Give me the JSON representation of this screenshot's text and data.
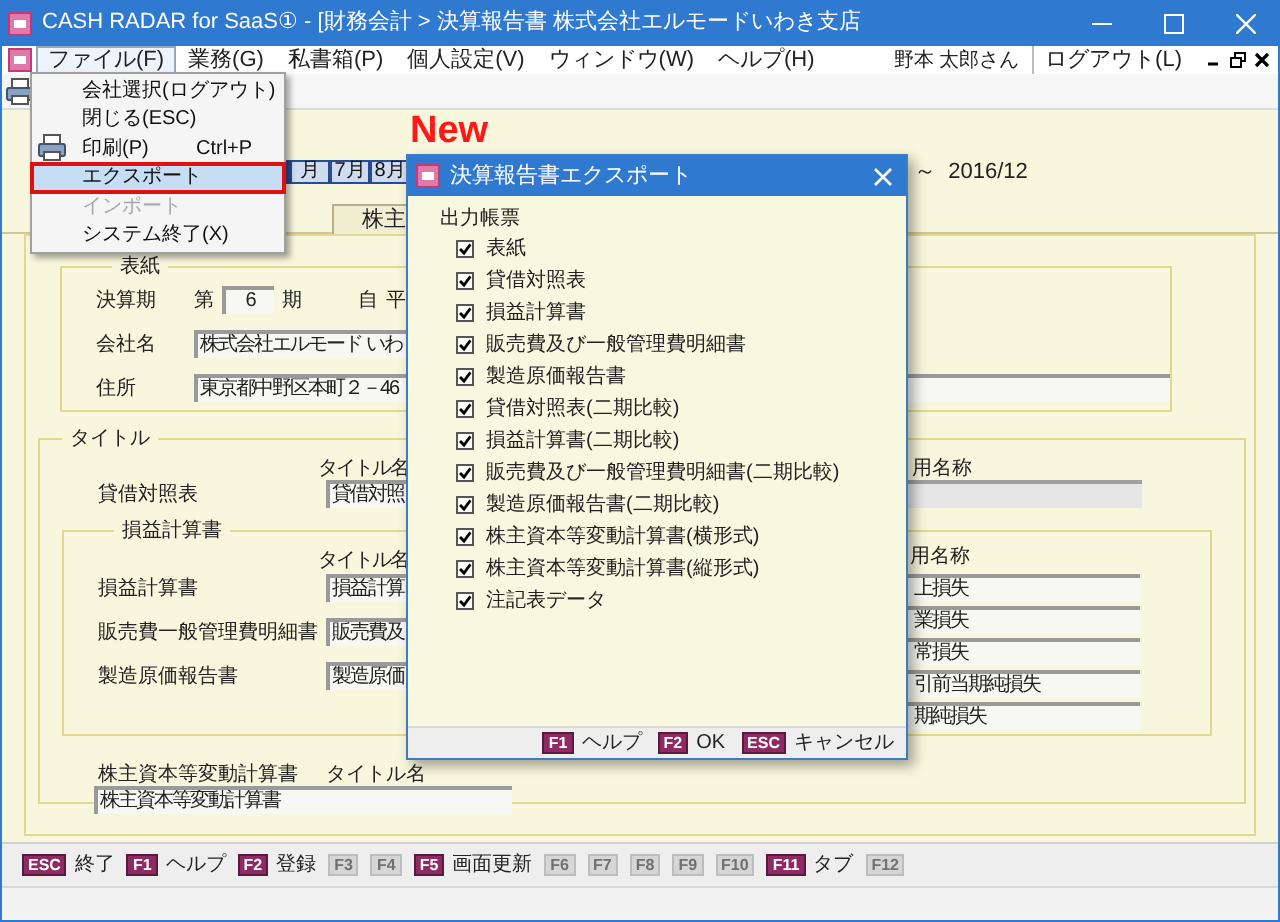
{
  "window": {
    "title": "CASH RADAR for SaaS① - [財務会計 > 決算報告書 株式会社エルモードいわき支店"
  },
  "menu_bar": {
    "items": [
      {
        "label": "ファイル(F)",
        "selected": true
      },
      {
        "label": "業務(G)",
        "selected": false
      },
      {
        "label": "私書箱(P)",
        "selected": false
      },
      {
        "label": "個人設定(V)",
        "selected": false
      },
      {
        "label": "ウィンドウ(W)",
        "selected": false
      },
      {
        "label": "ヘルプ(H)",
        "selected": false
      }
    ],
    "user": "野本 太郎さん",
    "logout": "ログアウト(L)"
  },
  "file_menu": {
    "items": [
      {
        "label": "会社選択(ログアウト)",
        "selected": false,
        "disabled": false
      },
      {
        "label": "閉じる(ESC)",
        "selected": false,
        "disabled": false
      },
      {
        "label": "印刷(P)",
        "shortcut": "Ctrl+P",
        "kind": "print",
        "selected": false,
        "disabled": false
      },
      {
        "label": "エクスポート",
        "selected": true,
        "disabled": false
      },
      {
        "label": "インポート",
        "selected": false,
        "disabled": true
      },
      {
        "label": "システム終了(X)",
        "selected": false,
        "disabled": false
      }
    ]
  },
  "annotation": "New",
  "period_bar": {
    "months": [
      "月",
      "7月",
      "8月"
    ],
    "range": "～  2016/12"
  },
  "tabs": [
    {
      "label": "株主",
      "selected": false
    }
  ],
  "cover": {
    "legend": "表紙",
    "period_label": "決算期",
    "period_prefix": "第",
    "period_value": "6",
    "period_suffix": "期",
    "from_label": "自",
    "from_value": "平",
    "company_label": "会社名",
    "company_value": "株式会社エルモード いわ",
    "address_label": "住所",
    "address_value": "東京都中野区本町２－46"
  },
  "titles": {
    "legend": "タイトル",
    "header_title": "タイトル名",
    "header_alt": "用名称",
    "rows": [
      {
        "label": "貸借対照表",
        "value": "貸借対照"
      }
    ]
  },
  "income": {
    "legend": "損益計算書",
    "header_title": "タイトル名",
    "header_alt": "用名称",
    "rows": [
      {
        "label": "損益計算書",
        "value": "損益計算"
      },
      {
        "label": "販売費一般管理費明細書",
        "value": "販売費及"
      },
      {
        "label": "製造原価報告書",
        "value": "製造原価"
      }
    ],
    "alt_values": [
      "上損失",
      "業損失",
      "常損失",
      "引前当期純損失",
      "期純損失"
    ]
  },
  "equity": {
    "label": "株主資本等変動計算書",
    "header_title": "タイトル名",
    "value": "株主資本等変動計算書"
  },
  "function_keys": [
    {
      "key": "ESC",
      "label": "終了",
      "disabled": false
    },
    {
      "key": "F1",
      "label": "ヘルプ",
      "disabled": false
    },
    {
      "key": "F2",
      "label": "登録",
      "disabled": false
    },
    {
      "key": "F3",
      "disabled": true
    },
    {
      "key": "F4",
      "disabled": true
    },
    {
      "key": "F5",
      "label": "画面更新",
      "disabled": false
    },
    {
      "key": "F6",
      "disabled": true
    },
    {
      "key": "F7",
      "disabled": true
    },
    {
      "key": "F8",
      "disabled": true
    },
    {
      "key": "F9",
      "disabled": true
    },
    {
      "key": "F10",
      "disabled": true
    },
    {
      "key": "F11",
      "label": "タブ",
      "disabled": false
    },
    {
      "key": "F12",
      "disabled": true
    }
  ],
  "dialog": {
    "title": "決算報告書エクスポート",
    "group": "出力帳票",
    "items": [
      {
        "label": "表紙",
        "checked": true
      },
      {
        "label": "貸借対照表",
        "checked": true
      },
      {
        "label": "損益計算書",
        "checked": true
      },
      {
        "label": "販売費及び一般管理費明細書",
        "checked": true
      },
      {
        "label": "製造原価報告書",
        "checked": true
      },
      {
        "label": "貸借対照表(二期比較)",
        "checked": true
      },
      {
        "label": "損益計算書(二期比較)",
        "checked": true
      },
      {
        "label": "販売費及び一般管理費明細書(二期比較)",
        "checked": true
      },
      {
        "label": "製造原価報告書(二期比較)",
        "checked": true
      },
      {
        "label": "株主資本等変動計算書(横形式)",
        "checked": true
      },
      {
        "label": "株主資本等変動計算書(縦形式)",
        "checked": true
      },
      {
        "label": "注記表データ",
        "checked": true
      }
    ],
    "buttons": [
      {
        "key": "F1",
        "label": "ヘルプ"
      },
      {
        "key": "F2",
        "label": "OK"
      },
      {
        "key": "ESC",
        "label": "キャンセル"
      }
    ]
  }
}
